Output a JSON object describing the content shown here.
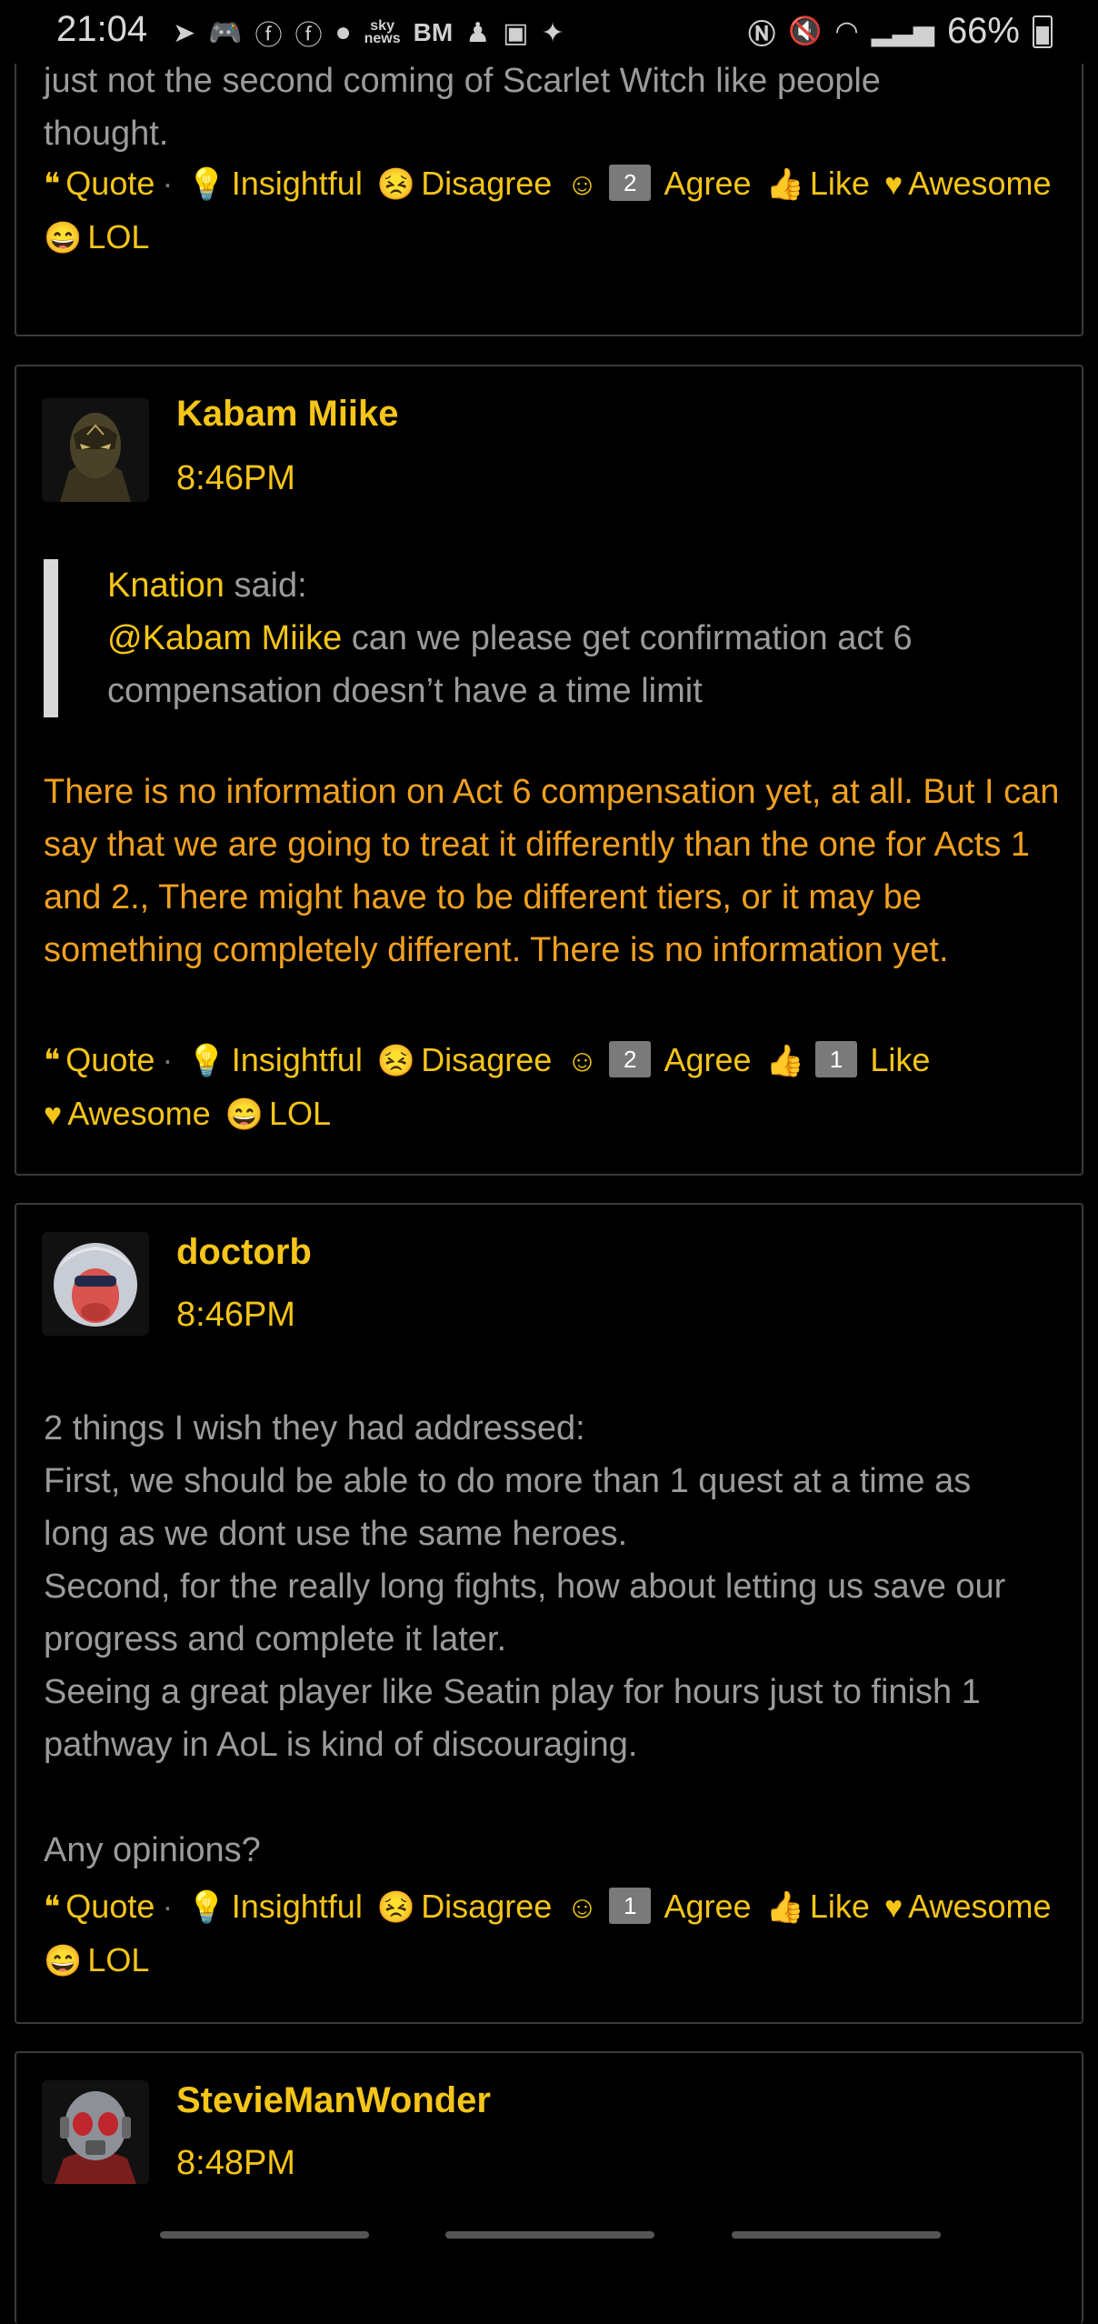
{
  "status_bar": {
    "time": "21:04",
    "sky_news": "sky\nnews",
    "bm": "BM",
    "battery": "66%"
  },
  "reaction_labels": {
    "quote": "Quote",
    "insightful": "Insightful",
    "disagree": "Disagree",
    "agree": "Agree",
    "like": "Like",
    "awesome": "Awesome",
    "lol": "LOL"
  },
  "posts": [
    {
      "body": "different story. Granted, Emma is not bad by any means,\njust not the second coming of Scarlet Witch like people\nthought.",
      "agree_count": "2",
      "like_count": ""
    },
    {
      "username": "Kabam Miike",
      "time": "8:46PM",
      "quote_author": "Knation",
      "quote_said": " said:",
      "quote_mention": "@Kabam Miike",
      "quote_text": " can we please get confirmation act 6 compensation doesn’t have a time limit",
      "body": "There is no information on Act 6 compensation yet, at all. But I can say that we are going to treat it differently than the one for Acts 1 and 2., There might have to be different tiers, or it may be something completely different. There is no information yet.",
      "agree_count": "2",
      "like_count": "1"
    },
    {
      "username": "doctorb",
      "time": "8:46PM",
      "body": "2 things I wish they had addressed:\nFirst, we should be able to do more than 1 quest at a time as long as we dont use the same heroes.\nSecond, for the really long fights, how about letting us save our progress and complete it later.\nSeeing a great player like Seatin play for hours just to finish 1 pathway in AoL is kind of discouraging.\n\nAny opinions?",
      "agree_count": "1",
      "like_count": ""
    },
    {
      "username": "StevieManWonder",
      "time": "8:48PM"
    }
  ]
}
